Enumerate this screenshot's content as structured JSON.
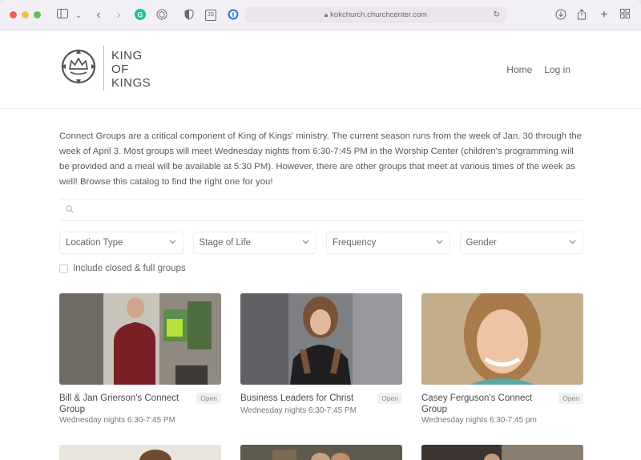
{
  "browser": {
    "url": "kokchurch.churchcenter.com",
    "extensions": [
      {
        "name": "grammarly-icon",
        "glyph": "G",
        "color": "#15c39a"
      },
      {
        "name": "cube-icon",
        "glyph": "⬡",
        "color": "#6b6670"
      },
      {
        "name": "shield-half-icon",
        "glyph": "◐",
        "color": "#6b6670"
      },
      {
        "name": "js-icon",
        "glyph": "JS",
        "color": "#6b6670"
      },
      {
        "name": "onepassword-icon",
        "glyph": "①",
        "color": "#3b7ce0"
      }
    ]
  },
  "header": {
    "logo_lines": [
      "KING",
      "OF",
      "KINGS"
    ],
    "nav": [
      {
        "label": "Home"
      },
      {
        "label": "Log in"
      }
    ]
  },
  "intro": "Connect Groups are a critical component of King of Kings' ministry. The current season runs from the week of Jan. 30 through the week of April 3. Most groups will meet Wednesday nights from 6:30-7:45 PM in the Worship Center (children's programming will be provided and a meal will be available at 5:30 PM). However, there are other groups that meet at various times of the week as well! Browse this catalog to find the right one for you!",
  "search": {
    "placeholder": ""
  },
  "filters": [
    {
      "label": "Location Type"
    },
    {
      "label": "Stage of Life"
    },
    {
      "label": "Frequency"
    },
    {
      "label": "Gender"
    }
  ],
  "closed_toggle": {
    "label": "Include closed & full groups",
    "checked": false
  },
  "groups": [
    {
      "title": "Bill & Jan Grierson's Connect Group",
      "status": "Open",
      "schedule": "Wednesday nights 6:30-7:45 PM"
    },
    {
      "title": "Business Leaders for Christ",
      "status": "Open",
      "schedule": "Wednesday nights 6:30-7:45 PM"
    },
    {
      "title": "Casey Ferguson's Connect Group",
      "status": "Open",
      "schedule": "Wednesday nights 6:30-7:45 pm"
    }
  ]
}
